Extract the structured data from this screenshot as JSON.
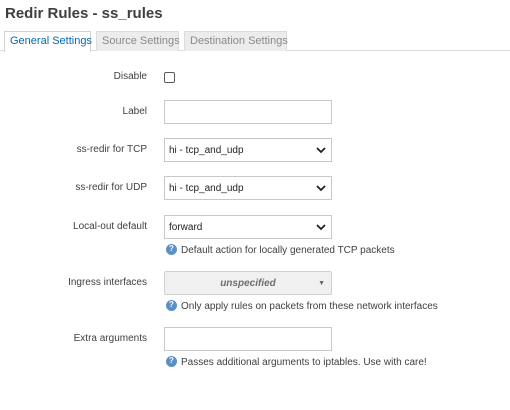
{
  "page": {
    "title": "Redir Rules - ss_rules"
  },
  "tabs": [
    {
      "label": "General Settings",
      "active": true
    },
    {
      "label": "Source Settings",
      "active": false
    },
    {
      "label": "Destination Settings",
      "active": false
    }
  ],
  "form": {
    "disable": {
      "label": "Disable",
      "checked": false
    },
    "label_field": {
      "label": "Label",
      "value": ""
    },
    "tcp": {
      "label": "ss-redir for TCP",
      "value": "hi - tcp_and_udp"
    },
    "udp": {
      "label": "ss-redir for UDP",
      "value": "hi - tcp_and_udp"
    },
    "local_out": {
      "label": "Local-out default",
      "value": "forward",
      "help": "Default action for locally generated TCP packets"
    },
    "ingress": {
      "label": "Ingress interfaces",
      "value": "unspecified",
      "help": "Only apply rules on packets from these network interfaces"
    },
    "extra": {
      "label": "Extra arguments",
      "value": "",
      "help": "Passes additional arguments to iptables. Use with care!"
    }
  },
  "colors": {
    "accent": "#0069b2",
    "help_icon": "#5b8fc7"
  }
}
